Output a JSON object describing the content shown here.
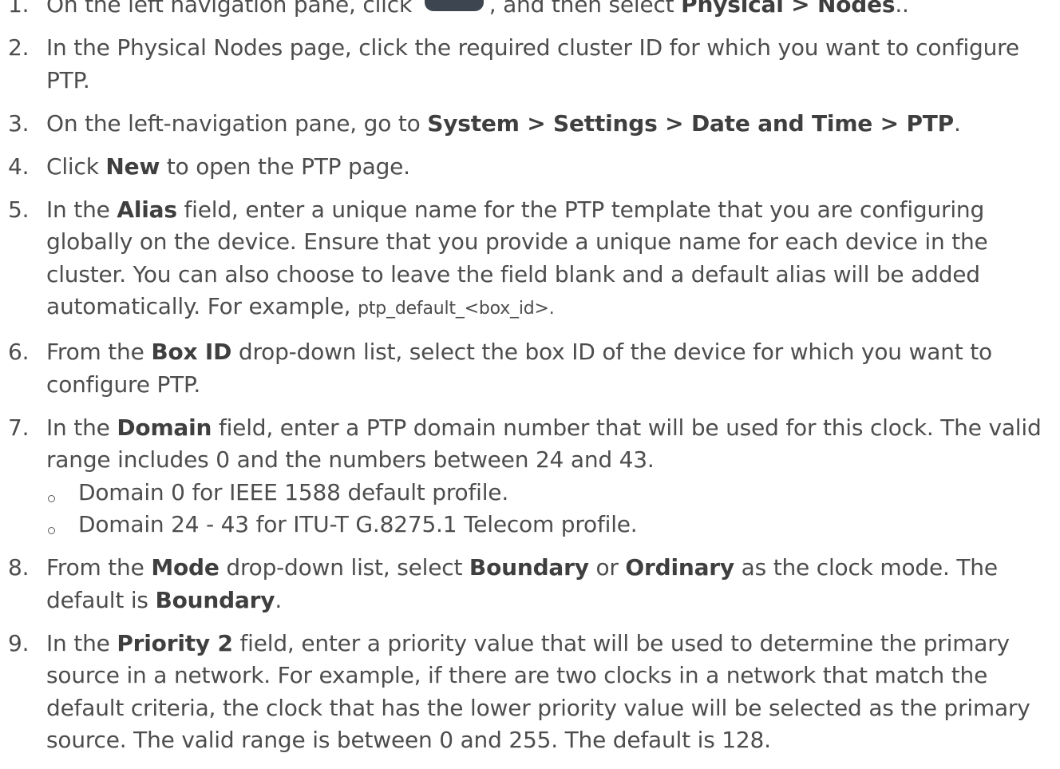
{
  "steps": [
    {
      "num": "1.",
      "pre": "On the left navigation pane, click ",
      "mid": ", and then select ",
      "bold": "Physical > Nodes",
      "post": ".."
    },
    {
      "num": "2.",
      "text": "In the Physical Nodes page, click the required cluster ID for which you want to configure PTP."
    },
    {
      "num": "3.",
      "pre": "On the left-navigation pane, go to ",
      "bold": "System > Settings > Date and Time > PTP",
      "post": "."
    },
    {
      "num": "4.",
      "pre": "Click ",
      "bold": "New",
      "post": " to open the PTP page."
    },
    {
      "num": "5.",
      "pre": "In the ",
      "bold": "Alias",
      "post": " field, enter a unique name for the PTP template that you are configuring globally on the device. Ensure that you provide a unique name for each device in the cluster. You can also choose to leave the field blank and a default alias will be added automatically. For example, ",
      "code": "ptp_default_<box_id>",
      "end": "."
    },
    {
      "num": "6.",
      "pre": "From the ",
      "bold": "Box ID",
      "post": " drop-down list, select the box ID of the device for which you want to configure PTP."
    },
    {
      "num": "7.",
      "pre": "In the ",
      "bold": "Domain",
      "post": " field, enter a PTP domain number that will be used for this clock. The valid range includes 0 and the numbers between 24 and 43.",
      "bullets": [
        "Domain 0 for IEEE 1588 default profile.",
        "Domain 24 - 43 for ITU-T G.8275.1 Telecom profile."
      ]
    },
    {
      "num": "8.",
      "pre": "From the ",
      "bold": "Mode",
      "post": " drop-down list, select ",
      "bold2": "Boundary",
      "post2": " or ",
      "bold3": "Ordinary",
      "post3": " as the clock mode. The default is ",
      "bold4": "Boundary",
      "end": "."
    },
    {
      "num": "9.",
      "pre": "In the ",
      "bold": "Priority 2",
      "post": " field, enter a priority value that will be used to determine the primary source in a network. For example, if there are two clocks in a network that match the default criteria, the clock that has the lower priority value will be selected as the primary source. The valid range is between 0 and 255. The default is 128."
    }
  ],
  "icons": {
    "nav_icon": "server-icon"
  },
  "colors": {
    "text": "#4d4d4d",
    "icon_dark": "#3d4650"
  }
}
